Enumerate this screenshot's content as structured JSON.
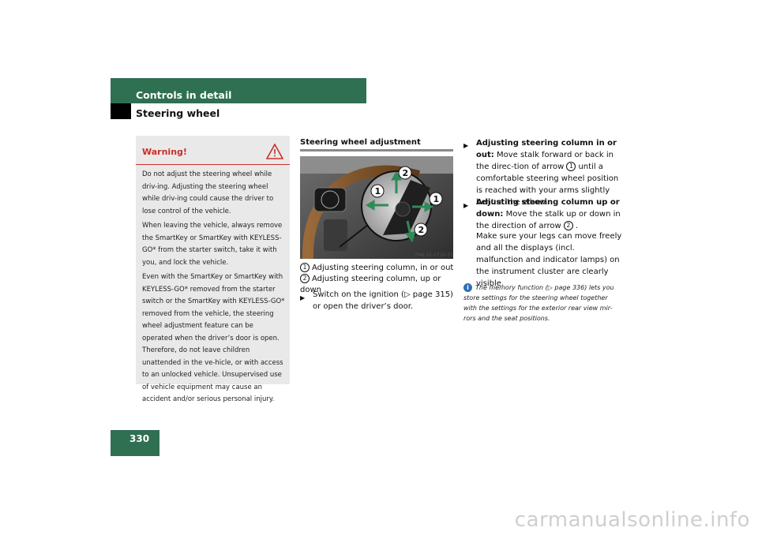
{
  "header": {
    "title": "Controls in detail",
    "subtitle": "Steering wheel"
  },
  "warning": {
    "title": "Warning!",
    "paragraphs": [
      "Do not adjust the steering wheel while driv-ing. Adjusting the steering wheel while driv-ing could cause the driver to lose control of the vehicle.",
      "When leaving the vehicle, always remove the SmartKey or SmartKey with KEYLESS-GO* from the starter switch, take it with you, and lock the vehicle.",
      "Even with the SmartKey or SmartKey with KEYLESS-GO* removed from the starter switch or the SmartKey with KEYLESS-GO* removed from the vehicle, the steering wheel adjustment feature can be operated when the driver’s door is open. Therefore, do not leave children unattended in the ve-hicle, or with access to an unlocked vehicle. Unsupervised use of vehicle equipment may cause an accident and/or serious personal injury."
    ]
  },
  "section": {
    "title": "Steering wheel adjustment",
    "figure_code": "P46.15-2720-31",
    "captions": [
      {
        "num": "1",
        "text": "Adjusting steering column, in or out"
      },
      {
        "num": "2",
        "text": "Adjusting steering column, up or down"
      }
    ],
    "step1": "Switch on the ignition (▷ page 315) or open the driver’s door."
  },
  "right": {
    "step_a_head": "Adjusting steering column in or out:",
    "step_a_body_1": "Move stalk forward or back in the direc-tion of arrow",
    "step_a_num": "1",
    "step_a_body_2": "until a comfortable steering wheel position is reached with your arms slightly bent at the elbow.",
    "step_b_head": "Adjusting steering column up or down:",
    "step_b_body_1": "Move the stalk up or down in the direction of arrow",
    "step_b_num": "2",
    "step_b_body_2": ".",
    "step_b_note": "Make sure your legs can move freely and all the displays (incl. malfunction and indicator lamps) on the instrument cluster are clearly visible.",
    "info": "The memory function (▷ page 336) lets you store settings for the steering wheel together with the settings for the exterior rear view mir-rors and the seat positions."
  },
  "page_number": "330",
  "watermark": "carmanualsonline.info",
  "colors": {
    "brand": "#2f6f52",
    "warning": "#c8302a",
    "info": "#2f6fb0"
  }
}
